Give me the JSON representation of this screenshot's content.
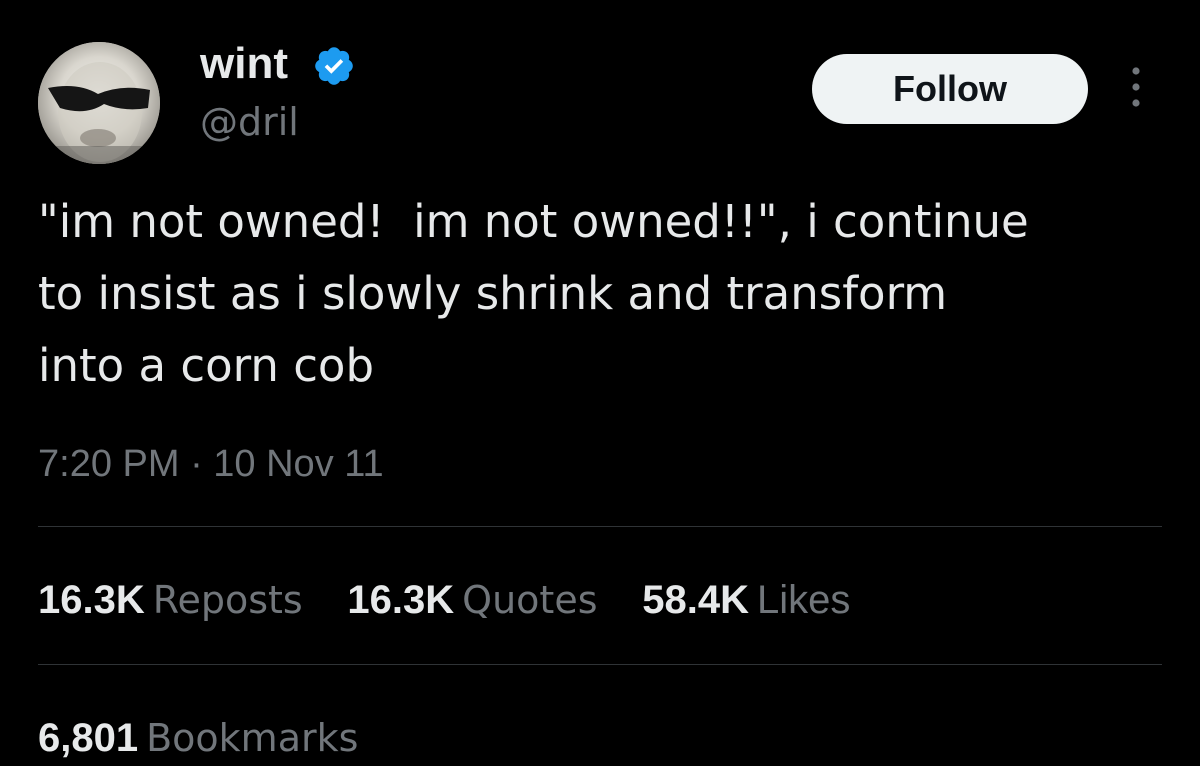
{
  "author": {
    "display_name": "wint",
    "handle": "@dril",
    "verified_icon": "verified-badge-icon",
    "verified_color": "#1d9bf0"
  },
  "follow_button": {
    "label": "Follow"
  },
  "more_icon": "more-vertical-icon",
  "tweet": {
    "lines": [
      "\"im not owned!  im not owned!!\", i continue",
      "to insist as i slowly shrink and transform",
      "into a corn cob"
    ],
    "timestamp": "7:20 PM · 10 Nov 11"
  },
  "stats": {
    "reposts": {
      "count": "16.3K",
      "label": "Reposts"
    },
    "quotes": {
      "count": "16.3K",
      "label": "Quotes"
    },
    "likes": {
      "count": "58.4K",
      "label": "Likes"
    },
    "bookmarks": {
      "count": "6,801",
      "label": "Bookmarks"
    }
  },
  "colors": {
    "background": "#000000",
    "primary_text": "#e7e9ea",
    "secondary_text": "#71767b",
    "divider": "#2f3336",
    "follow_bg": "#eff3f4"
  }
}
